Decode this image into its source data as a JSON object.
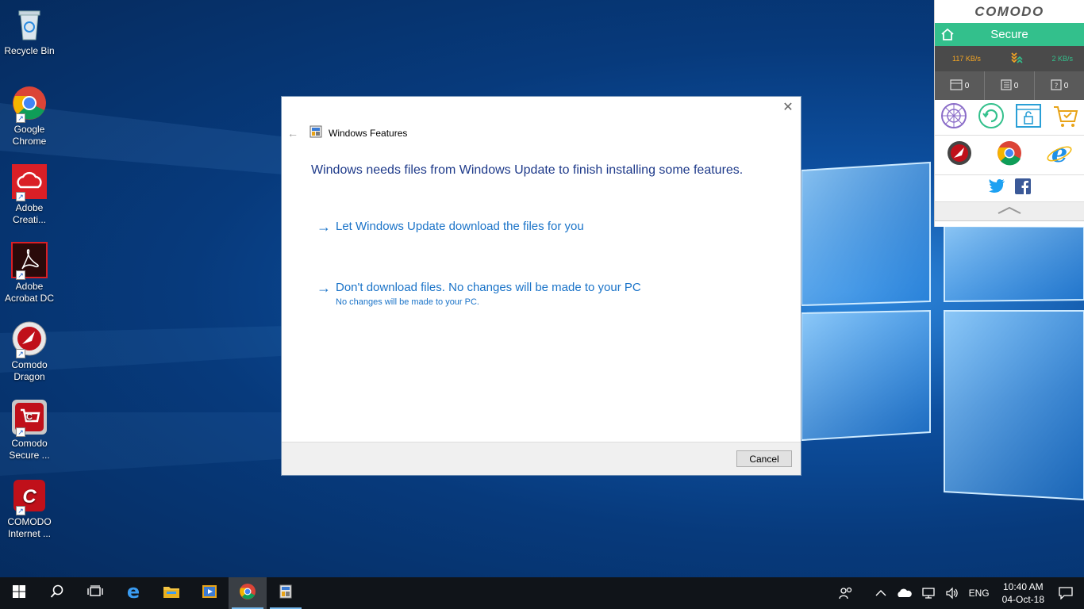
{
  "desktop": {
    "icons": [
      {
        "label": "Recycle Bin"
      },
      {
        "label": "Google Chrome"
      },
      {
        "label": "Adobe Creati..."
      },
      {
        "label": "Adobe Acrobat DC"
      },
      {
        "label": "Comodo Dragon"
      },
      {
        "label": "Comodo Secure ..."
      },
      {
        "label": "COMODO Internet ..."
      }
    ]
  },
  "widget": {
    "brand": "COMODO",
    "status": "Secure",
    "download_speed": "117 KB/s",
    "upload_speed": "2 KB/s",
    "counters": [
      "0",
      "0",
      "0"
    ],
    "colors": {
      "status_bg": "#33c08c",
      "speed": "#f5a623"
    }
  },
  "dialog": {
    "title": "Windows Features",
    "close_label": "✕",
    "heading": "Windows needs files from Windows Update to finish installing some features.",
    "options": [
      {
        "main": "Let Windows Update download the files for you",
        "sub": ""
      },
      {
        "main": "Don't download files. No changes will be made to your PC",
        "sub": "No changes will be made to your PC."
      }
    ],
    "cancel_label": "Cancel"
  },
  "taskbar": {
    "language": "ENG",
    "time": "10:40 AM",
    "date": "04-Oct-18"
  }
}
